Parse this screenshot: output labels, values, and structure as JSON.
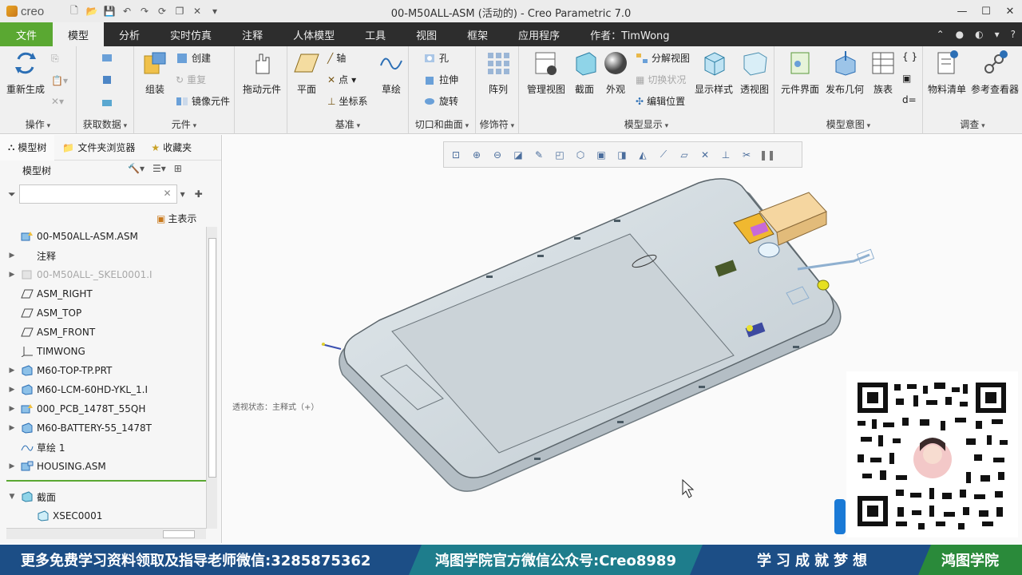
{
  "app": {
    "logo_text": "creo",
    "window_title": "00-M50ALL-ASM (活动的) - Creo Parametric 7.0"
  },
  "tabs": [
    {
      "label": "文件"
    },
    {
      "label": "模型"
    },
    {
      "label": "分析"
    },
    {
      "label": "实时仿真"
    },
    {
      "label": "注释"
    },
    {
      "label": "人体模型"
    },
    {
      "label": "工具"
    },
    {
      "label": "视图"
    },
    {
      "label": "框架"
    },
    {
      "label": "应用程序"
    },
    {
      "label": "作者：TimWong"
    }
  ],
  "ribbon": {
    "groups": {
      "operation": "操作",
      "get_data": "获取数据",
      "component": "元件",
      "datum": "基准",
      "cut_surface": "切口和曲面",
      "modifier": "修饰符",
      "model_display": "模型显示",
      "model_intent": "模型意图",
      "investigate": "调查"
    },
    "buttons": {
      "regenerate": "重新生成",
      "assemble": "组装",
      "create": "创建",
      "repeat": "重复",
      "mirror": "镜像元件",
      "drag": "拖动元件",
      "plane": "平面",
      "axis": "轴",
      "point": "点",
      "csys": "坐标系",
      "sketch": "草绘",
      "hole": "孔",
      "extrude": "拉伸",
      "revolve": "旋转",
      "pattern": "阵列",
      "manage_views": "管理视图",
      "section": "截面",
      "appearance": "外观",
      "explode": "分解视图",
      "toggle_status": "切换状况",
      "edit_position": "编辑位置",
      "display_style": "显示样式",
      "perspective": "透视图",
      "component_interface": "元件界面",
      "publish_geom": "发布几何",
      "family_table": "族表",
      "bom": "物料清单",
      "ref_viewer": "参考查看器"
    }
  },
  "left_panel": {
    "tabs": [
      "模型树",
      "文件夹浏览器",
      "收藏夹"
    ],
    "title": "模型树",
    "filter_placeholder": "",
    "main_show": "主表示",
    "tree": [
      {
        "label": "00-M50ALL-ASM.ASM",
        "icon": "assembly-icon",
        "expand": ""
      },
      {
        "label": "注释",
        "icon": "",
        "expand": "▶"
      },
      {
        "label": "00-M50ALL-_SKEL0001.I",
        "icon": "skeleton-icon",
        "expand": "▶",
        "dim": true
      },
      {
        "label": "ASM_RIGHT",
        "icon": "datum-plane-icon",
        "expand": ""
      },
      {
        "label": "ASM_TOP",
        "icon": "datum-plane-icon",
        "expand": ""
      },
      {
        "label": "ASM_FRONT",
        "icon": "datum-plane-icon",
        "expand": ""
      },
      {
        "label": "TIMWONG",
        "icon": "csys-icon",
        "expand": ""
      },
      {
        "label": "M60-TOP-TP.PRT",
        "icon": "part-icon",
        "expand": "▶"
      },
      {
        "label": "M60-LCM-60HD-YKL_1.I",
        "icon": "part-icon",
        "expand": "▶"
      },
      {
        "label": "000_PCB_1478T_55QH",
        "icon": "assembly-icon",
        "expand": "▶"
      },
      {
        "label": "M60-BATTERY-55_1478T",
        "icon": "part-icon",
        "expand": "▶"
      },
      {
        "label": "草绘 1",
        "icon": "sketch-icon",
        "expand": ""
      },
      {
        "label": "HOUSING.ASM",
        "icon": "assembly-icon",
        "expand": "▶"
      }
    ],
    "sections_label": "截面",
    "section_item": "XSEC0001"
  },
  "graphics": {
    "status_text": "透视状态：主释式（+）"
  },
  "banner": {
    "left": "更多免费学习资料领取及指导老师微信:3285875362",
    "middle": "鸿图学院官方微信公众号:Creo8989",
    "right": "学习成就梦想",
    "brand": "鸿图学院"
  },
  "colors": {
    "file_tab": "#5aa832",
    "tab_bar": "#2d2d2d",
    "banner_blue": "#1c4e86",
    "banner_teal": "#1e7d8c",
    "banner_green": "#2a8a3a"
  }
}
